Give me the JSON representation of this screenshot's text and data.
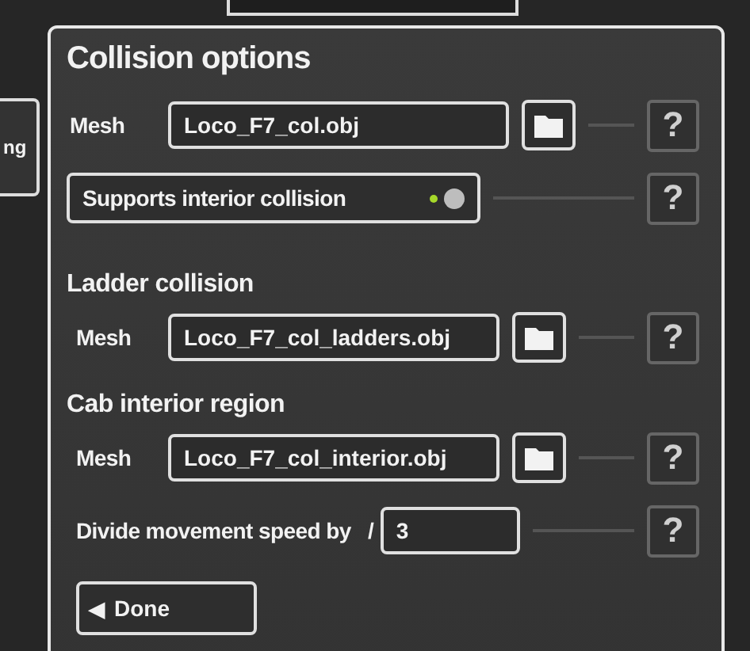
{
  "background_tab": {
    "label": "ng"
  },
  "panel": {
    "title": "Collision options"
  },
  "rows": [
    {
      "kind": "file",
      "label": "Mesh",
      "value": "Loco_F7_col.obj",
      "help": "?"
    },
    {
      "kind": "toggle",
      "label": "Supports interior collision",
      "on": true,
      "help": "?"
    },
    {
      "kind": "heading",
      "label": "Ladder collision"
    },
    {
      "kind": "file",
      "label": "Mesh",
      "value": "Loco_F7_col_ladders.obj",
      "help": "?"
    },
    {
      "kind": "heading",
      "label": "Cab interior region"
    },
    {
      "kind": "file",
      "label": "Mesh",
      "value": "Loco_F7_col_interior.obj",
      "help": "?"
    },
    {
      "kind": "number",
      "label": "Divide movement speed by",
      "prefix": "/",
      "value": "3",
      "help": "?"
    }
  ],
  "done_button": {
    "icon": "◀",
    "label": "Done"
  }
}
